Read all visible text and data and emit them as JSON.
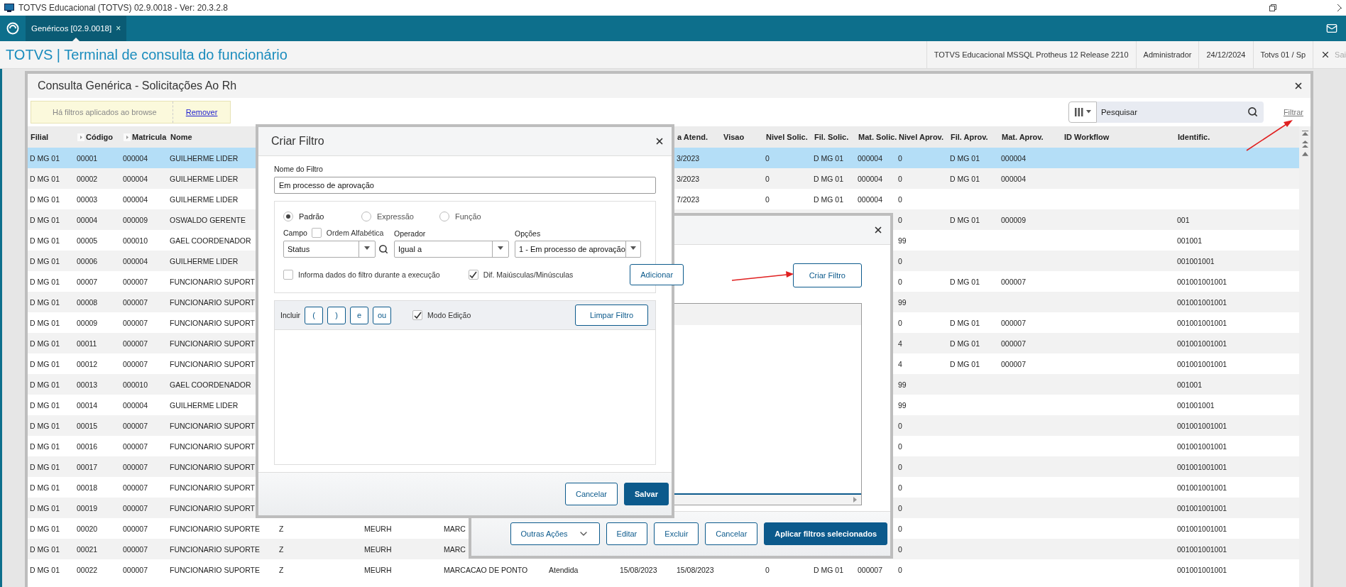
{
  "title_bar": {
    "title": "TOTVS Educacional (TOTVS) 02.9.0018 - Ver: 20.3.2.8"
  },
  "tab_bar": {
    "tabs": [
      {
        "label": "Genéricos [02.9.0018]",
        "selected": true,
        "close": "×"
      }
    ]
  },
  "header": {
    "title": "TOTVS | Terminal de consulta do funcionário",
    "info": [
      "TOTVS Educacional MSSQL Protheus 12 Release 2210",
      "Administrador",
      "24/12/2024",
      "Totvs 01 / Sp"
    ],
    "exit": "Sai"
  },
  "consulta": {
    "title": "Consulta Genérica - Solicitações Ao Rh",
    "notice": "Há filtros aplicados ao browse",
    "notice_link": "Remover",
    "search": {
      "placeholder": "Pesquisar"
    },
    "filter_link": "Filtrar",
    "table": {
      "columns": [
        {
          "label": "Filial",
          "marker": false
        },
        {
          "label": "Código",
          "marker": true
        },
        {
          "label": "Matricula",
          "marker": true
        },
        {
          "label": "Nome",
          "marker": false
        },
        {},
        {},
        {},
        {},
        {},
        {
          "label": "a Atend.",
          "marker": false
        },
        {
          "label": "Visao",
          "marker": false
        },
        {
          "label": "Nivel Solic.",
          "marker": false
        },
        {
          "label": "Fil. Solic.",
          "marker": false
        },
        {
          "label": "Mat. Solic.",
          "marker": false
        },
        {
          "label": "Nivel Aprov.",
          "marker": false
        },
        {
          "label": "Fil. Aprov.",
          "marker": false
        },
        {
          "label": "Mat. Aprov.",
          "marker": false
        },
        {
          "label": "ID Workflow",
          "marker": false
        },
        {
          "label": "Identific.",
          "marker": false
        }
      ],
      "rows": [
        {
          "selected": true,
          "cells": [
            "D MG 01",
            "00001",
            "000004",
            "GUILHERME LIDER",
            null,
            null,
            null,
            null,
            null,
            "3/2023",
            null,
            "0",
            "D MG 01",
            "000004",
            "0",
            "D MG 01",
            "000004",
            null,
            null
          ]
        },
        {
          "selected": false,
          "cells": [
            "D MG 01",
            "00002",
            "000004",
            "GUILHERME LIDER",
            null,
            null,
            null,
            null,
            null,
            "3/2023",
            null,
            "0",
            "D MG 01",
            "000004",
            "0",
            "D MG 01",
            "000004",
            null,
            null
          ]
        },
        {
          "selected": false,
          "cells": [
            "D MG 01",
            "00003",
            "000004",
            "GUILHERME LIDER",
            null,
            null,
            null,
            null,
            null,
            "7/2023",
            null,
            "0",
            "D MG 01",
            "000004",
            "0",
            null,
            null,
            null,
            null
          ]
        },
        {
          "selected": false,
          "cells": [
            "D MG 01",
            "00004",
            "000009",
            "OSWALDO GERENTE",
            null,
            null,
            null,
            null,
            null,
            null,
            null,
            null,
            null,
            null,
            "0",
            "D MG 01",
            "000009",
            null,
            "001"
          ]
        },
        {
          "selected": false,
          "cells": [
            "D MG 01",
            "00005",
            "000010",
            "GAEL COORDENADOR",
            null,
            null,
            null,
            null,
            null,
            null,
            null,
            null,
            null,
            null,
            "99",
            null,
            null,
            null,
            "001001"
          ]
        },
        {
          "selected": false,
          "cells": [
            "D MG 01",
            "00006",
            "000004",
            "GUILHERME LIDER",
            null,
            null,
            null,
            null,
            null,
            null,
            null,
            null,
            null,
            null,
            "0",
            null,
            null,
            null,
            "001001001"
          ]
        },
        {
          "selected": false,
          "cells": [
            "D MG 01",
            "00007",
            "000007",
            "FUNCIONARIO SUPORT",
            null,
            null,
            null,
            null,
            null,
            null,
            null,
            null,
            null,
            null,
            "0",
            "D MG 01",
            "000007",
            null,
            "001001001001"
          ]
        },
        {
          "selected": false,
          "cells": [
            "D MG 01",
            "00008",
            "000007",
            "FUNCIONARIO SUPORT",
            null,
            null,
            null,
            null,
            null,
            null,
            null,
            null,
            null,
            null,
            "99",
            null,
            null,
            null,
            "001001001001"
          ]
        },
        {
          "selected": false,
          "cells": [
            "D MG 01",
            "00009",
            "000007",
            "FUNCIONARIO SUPORT",
            null,
            null,
            null,
            null,
            null,
            null,
            null,
            null,
            null,
            null,
            "0",
            "D MG 01",
            "000007",
            null,
            "001001001001"
          ]
        },
        {
          "selected": false,
          "cells": [
            "D MG 01",
            "00011",
            "000007",
            "FUNCIONARIO SUPORT",
            null,
            null,
            null,
            null,
            null,
            null,
            null,
            null,
            null,
            null,
            "4",
            "D MG 01",
            "000007",
            null,
            "001001001001"
          ]
        },
        {
          "selected": false,
          "cells": [
            "D MG 01",
            "00012",
            "000007",
            "FUNCIONARIO SUPORT",
            null,
            null,
            null,
            null,
            null,
            null,
            null,
            null,
            null,
            null,
            "4",
            "D MG 01",
            "000007",
            null,
            "001001001001"
          ]
        },
        {
          "selected": false,
          "cells": [
            "D MG 01",
            "00013",
            "000010",
            "GAEL COORDENADOR",
            null,
            null,
            null,
            null,
            null,
            null,
            null,
            null,
            null,
            null,
            "99",
            null,
            null,
            null,
            "001001"
          ]
        },
        {
          "selected": false,
          "cells": [
            "D MG 01",
            "00014",
            "000004",
            "GUILHERME LIDER",
            null,
            null,
            null,
            null,
            null,
            null,
            null,
            null,
            null,
            null,
            "99",
            null,
            null,
            null,
            "001001001"
          ]
        },
        {
          "selected": false,
          "cells": [
            "D MG 01",
            "00015",
            "000007",
            "FUNCIONARIO SUPORT",
            null,
            null,
            null,
            null,
            null,
            null,
            null,
            null,
            null,
            null,
            "0",
            null,
            null,
            null,
            "001001001001"
          ]
        },
        {
          "selected": false,
          "cells": [
            "D MG 01",
            "00016",
            "000007",
            "FUNCIONARIO SUPORT",
            null,
            null,
            null,
            null,
            null,
            null,
            null,
            null,
            null,
            null,
            "0",
            null,
            null,
            null,
            "001001001001"
          ]
        },
        {
          "selected": false,
          "cells": [
            "D MG 01",
            "00017",
            "000007",
            "FUNCIONARIO SUPORT",
            null,
            null,
            null,
            null,
            null,
            null,
            null,
            null,
            null,
            null,
            "0",
            null,
            null,
            null,
            "001001001001"
          ]
        },
        {
          "selected": false,
          "cells": [
            "D MG 01",
            "00018",
            "000007",
            "FUNCIONARIO SUPORT",
            null,
            null,
            null,
            null,
            null,
            null,
            null,
            null,
            null,
            null,
            "0",
            null,
            null,
            null,
            "001001001001"
          ]
        },
        {
          "selected": false,
          "cells": [
            "D MG 01",
            "00019",
            "000007",
            "FUNCIONARIO SUPORT",
            null,
            null,
            null,
            null,
            null,
            null,
            null,
            null,
            null,
            null,
            "0",
            null,
            null,
            null,
            "001001001001"
          ]
        },
        {
          "selected": false,
          "cells": [
            "D MG 01",
            "00020",
            "000007",
            "FUNCIONARIO SUPORTE",
            "Z",
            "MEURH",
            "MARC",
            null,
            null,
            null,
            null,
            null,
            null,
            null,
            "0",
            null,
            null,
            null,
            "001001001001"
          ]
        },
        {
          "selected": false,
          "cells": [
            "D MG 01",
            "00021",
            "000007",
            "FUNCIONARIO SUPORTE",
            "Z",
            "MEURH",
            "MARC",
            null,
            null,
            null,
            null,
            null,
            null,
            null,
            "0",
            null,
            null,
            null,
            "001001001001"
          ]
        },
        {
          "selected": false,
          "cells": [
            "D MG 01",
            "00022",
            "000007",
            "FUNCIONARIO SUPORTE",
            "Z",
            "MEURH",
            "MARCACAO DE PONTO",
            "Atendida",
            "15/08/2023",
            "15/08/2023",
            null,
            "0",
            "D MG 01",
            "000007",
            "0",
            null,
            null,
            null,
            "001001001001"
          ]
        }
      ]
    }
  },
  "filters_dialog": {
    "create_button": "Criar Filtro",
    "buttons": [
      {
        "label": "Outras Ações",
        "kind": "menu"
      },
      {
        "label": "Editar",
        "kind": "secondary"
      },
      {
        "label": "Excluir",
        "kind": "secondary"
      },
      {
        "label": "Cancelar",
        "kind": "secondary"
      },
      {
        "label": "Aplicar filtros selecionados",
        "kind": "primary"
      }
    ]
  },
  "create_filter_dialog": {
    "title": "Criar Filtro",
    "name_label": "Nome do Filtro",
    "name_value": "Em processo de aprovação",
    "radios": [
      {
        "label": "Padrão",
        "selected": true
      },
      {
        "label": "Expressão",
        "selected": false
      },
      {
        "label": "Função",
        "selected": false
      }
    ],
    "campo": {
      "label": "Campo",
      "value": "Status"
    },
    "ordem": {
      "label": "Ordem Alfabética",
      "checked": false
    },
    "operador": {
      "label": "Operador",
      "value": "Igual a"
    },
    "opcoes": {
      "label": "Opções",
      "value": "1 - Em processo de aprovação"
    },
    "informa": {
      "label": "Informa dados do filtro durante a execução",
      "checked": false
    },
    "dif": {
      "label": "Dif. Maiúsculas/Minúsculas",
      "checked": true
    },
    "add_button": "Adicionar",
    "include_label": "Incluir",
    "operators": [
      "(",
      ")",
      "e",
      "ou"
    ],
    "modo_edicao": {
      "label": "Modo Edição",
      "checked": true
    },
    "clear_button": "Limpar Filtro",
    "buttons": [
      {
        "label": "Cancelar",
        "kind": "secondary"
      },
      {
        "label": "Salvar",
        "kind": "primary"
      }
    ]
  }
}
